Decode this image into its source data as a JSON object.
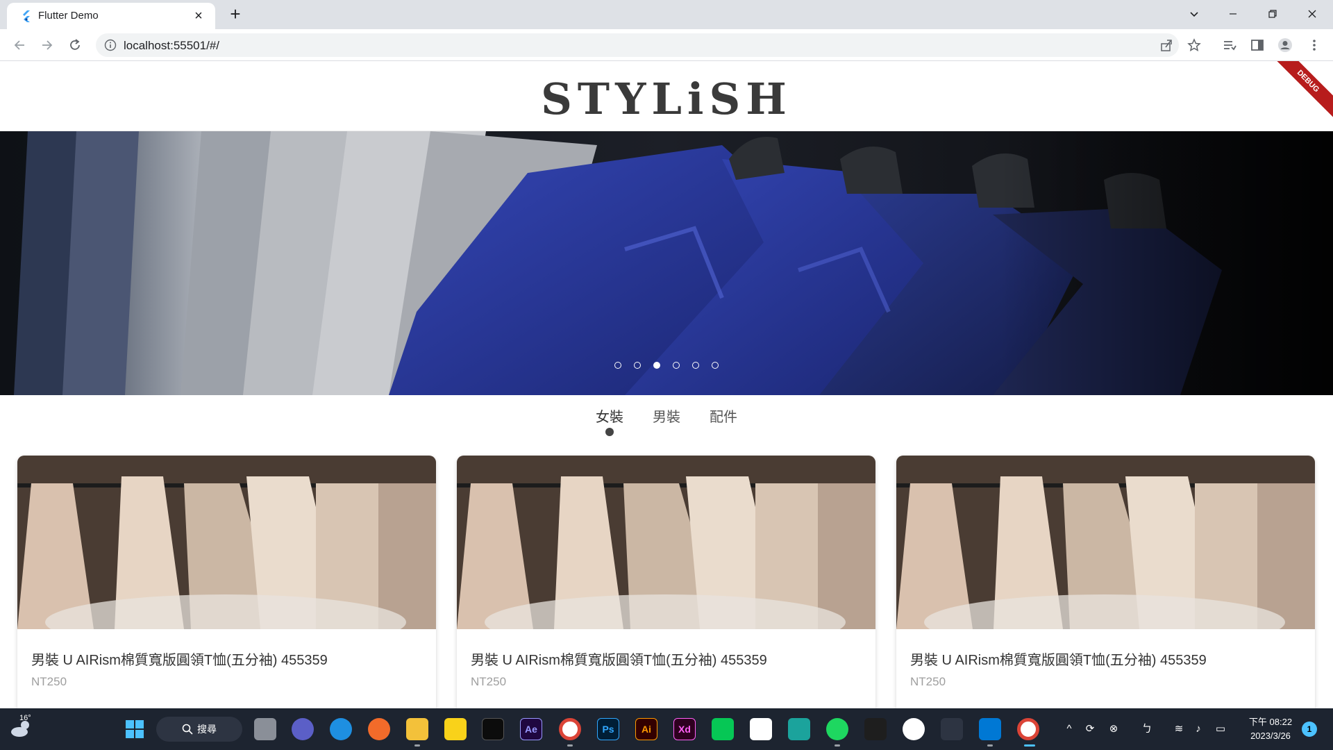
{
  "browser": {
    "tab_title": "Flutter Demo",
    "url": "localhost:55501/#/"
  },
  "app": {
    "logo": "STYLiSH",
    "debug_label": "DEBUG",
    "banner": {
      "slides": 6,
      "active_slide": 3
    },
    "categories": [
      {
        "label": "女裝",
        "active": true
      },
      {
        "label": "男裝",
        "active": false
      },
      {
        "label": "配件",
        "active": false
      }
    ],
    "products": [
      {
        "title": "男裝 U AIRism棉質寬版圓領T恤(五分袖) 455359",
        "price": "NT250"
      },
      {
        "title": "男裝 U AIRism棉質寬版圓領T恤(五分袖) 455359",
        "price": "NT250"
      },
      {
        "title": "男裝 U AIRism棉質寬版圓領T恤(五分袖) 455359",
        "price": "NT250"
      }
    ]
  },
  "taskbar": {
    "temperature": "16°",
    "search_label": "搜尋",
    "time": "下午 08:22",
    "date": "2023/3/26",
    "notifications": "1",
    "apps": [
      {
        "name": "file-explorer-icon",
        "label": "",
        "color": "#f3c13a"
      },
      {
        "name": "ae-icon",
        "label": "Ae",
        "color": "#1f0740"
      },
      {
        "name": "ps-icon",
        "label": "Ps",
        "color": "#001e36"
      },
      {
        "name": "ai-icon",
        "label": "Ai",
        "color": "#330000"
      },
      {
        "name": "xd-icon",
        "label": "Xd",
        "color": "#2e001f"
      }
    ]
  }
}
